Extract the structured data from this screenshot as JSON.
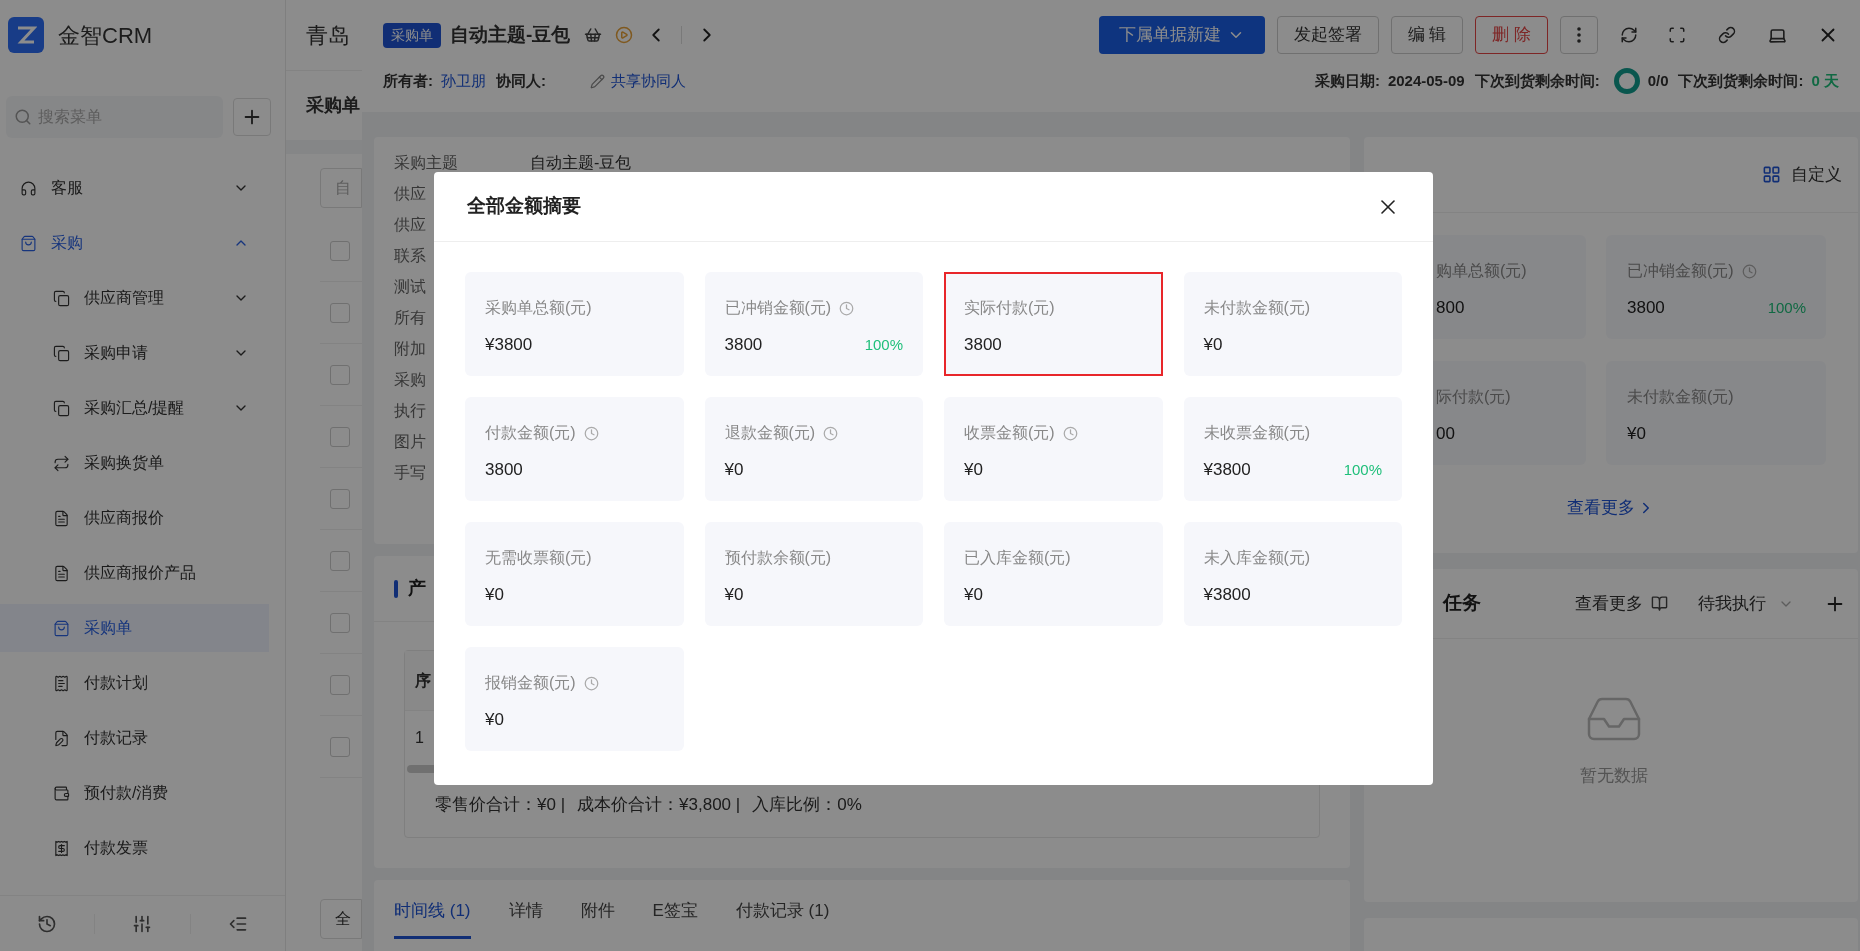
{
  "app": {
    "logo": "金智CRM",
    "company": "青岛"
  },
  "sidebar": {
    "search": {
      "placeholder": "搜索菜单"
    },
    "items": [
      {
        "label": "客服",
        "kind": "group",
        "expanded": false
      },
      {
        "label": "采购",
        "kind": "group",
        "expanded": true,
        "children": [
          {
            "label": "供应商管理",
            "kind": "group",
            "expanded": false,
            "selected": false
          },
          {
            "label": "采购申请",
            "kind": "group",
            "expanded": false,
            "selected": false
          },
          {
            "label": "采购汇总/提醒",
            "kind": "group",
            "expanded": false,
            "selected": false
          },
          {
            "label": "采购换货单",
            "kind": "page",
            "selected": false
          },
          {
            "label": "供应商报价",
            "kind": "page",
            "selected": false
          },
          {
            "label": "供应商报价产品",
            "kind": "page",
            "selected": false
          },
          {
            "label": "采购单",
            "kind": "page",
            "selected": true
          },
          {
            "label": "付款计划",
            "kind": "page",
            "selected": false
          },
          {
            "label": "付款记录",
            "kind": "page",
            "selected": false
          },
          {
            "label": "预付款/消费",
            "kind": "page",
            "selected": false
          },
          {
            "label": "付款发票",
            "kind": "page",
            "selected": false
          }
        ]
      }
    ]
  },
  "list_page": {
    "title": "采购单",
    "filter": "自",
    "rows": [
      {
        "checked": false
      },
      {
        "checked": false
      },
      {
        "checked": false
      },
      {
        "checked": false
      },
      {
        "checked": false
      },
      {
        "checked": false
      },
      {
        "checked": false
      },
      {
        "checked": false
      },
      {
        "checked": false
      }
    ],
    "all_button": "全"
  },
  "record": {
    "badge": "采购单",
    "title": "自动主题-豆包",
    "primary_action": "下属单据新建",
    "buttons": [
      {
        "label": "发起签署",
        "kind": "default"
      },
      {
        "label": "编 辑",
        "kind": "default"
      },
      {
        "label": "删 除",
        "kind": "danger"
      }
    ],
    "owner_label": "所有者:",
    "owner": "孙卫朋",
    "collaborator_label": "协同人:",
    "share_link": "共享协同人",
    "fields": [
      {
        "label": "采购日期:",
        "value": "2024-05-09",
        "kind": "text"
      },
      {
        "label": "下次到货剩余时间:",
        "value": "0/0",
        "kind": "ring"
      },
      {
        "label": "下次到货剩余时间:",
        "value": "0 天",
        "kind": "days"
      }
    ]
  },
  "info": {
    "rows": [
      {
        "label": "采购主题",
        "value": "自动主题-豆包"
      },
      {
        "label": "供应"
      },
      {
        "label": "供应"
      },
      {
        "label": "联系"
      },
      {
        "label": "测试"
      },
      {
        "label": "所有"
      },
      {
        "label": "附加"
      },
      {
        "label": "采购"
      },
      {
        "label": "执行"
      },
      {
        "label": "图片"
      },
      {
        "label": "手写"
      }
    ]
  },
  "products": {
    "title": "产",
    "table": {
      "columns": [
        "序"
      ],
      "rows": [
        [
          "1"
        ]
      ]
    },
    "totals": [
      "零售价合计：¥0 |",
      "成本价合计：¥3,800 |",
      "入库比例：0%"
    ]
  },
  "tabs": [
    {
      "label": "时间线 (1)",
      "selected": true
    },
    {
      "label": "详情",
      "selected": false
    },
    {
      "label": "附件",
      "selected": false
    },
    {
      "label": "E签宝",
      "selected": false
    },
    {
      "label": "付款记录 (1)",
      "selected": false
    }
  ],
  "summary": {
    "customize": "自定义",
    "more": "查看更多",
    "cards": [
      {
        "label": "购单总额(元)",
        "value": "800",
        "info_icon": false
      },
      {
        "label": "已冲销金额(元)",
        "value": "3800",
        "info_icon": true,
        "percent": "100%"
      },
      {
        "label": "际付款(元)",
        "value": "00",
        "info_icon": false
      },
      {
        "label": "未付款金额(元)",
        "value": "¥0",
        "info_icon": false
      }
    ]
  },
  "tasks": {
    "title": "任务",
    "more": "查看更多",
    "filter": "待我执行",
    "empty": "暂无数据"
  },
  "modal": {
    "title": "全部金额摘要",
    "cards": [
      {
        "label": "采购单总额(元)",
        "value": "¥3800",
        "info_icon": false,
        "highlighted": false
      },
      {
        "label": "已冲销金额(元)",
        "value": "3800",
        "info_icon": true,
        "percent": "100%",
        "highlighted": false
      },
      {
        "label": "实际付款(元)",
        "value": "3800",
        "info_icon": false,
        "highlighted": true
      },
      {
        "label": "未付款金额(元)",
        "value": "¥0",
        "info_icon": false,
        "highlighted": false
      },
      {
        "label": "付款金额(元)",
        "value": "3800",
        "info_icon": true,
        "highlighted": false
      },
      {
        "label": "退款金额(元)",
        "value": "¥0",
        "info_icon": true,
        "highlighted": false
      },
      {
        "label": "收票金额(元)",
        "value": "¥0",
        "info_icon": true,
        "highlighted": false
      },
      {
        "label": "未收票金额(元)",
        "value": "¥3800",
        "info_icon": false,
        "percent": "100%",
        "highlighted": false
      },
      {
        "label": "无需收票额(元)",
        "value": "¥0",
        "info_icon": false,
        "highlighted": false
      },
      {
        "label": "预付款余额(元)",
        "value": "¥0",
        "info_icon": false,
        "highlighted": false
      },
      {
        "label": "已入库金额(元)",
        "value": "¥0",
        "info_icon": false,
        "highlighted": false
      },
      {
        "label": "未入库金额(元)",
        "value": "¥3800",
        "info_icon": false,
        "highlighted": false
      },
      {
        "label": "报销金额(元)",
        "value": "¥0",
        "info_icon": true,
        "highlighted": false
      }
    ]
  }
}
